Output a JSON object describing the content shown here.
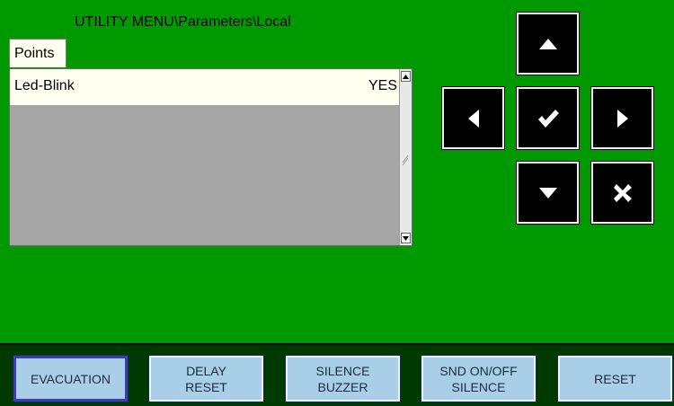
{
  "header": {
    "title": "UTILITY MENU\\Parameters\\Local"
  },
  "tab": {
    "label": "Points"
  },
  "list": {
    "rows": [
      {
        "name": "Led-Blink",
        "value": "YES"
      }
    ]
  },
  "nav": {
    "up": "up-arrow-icon",
    "left": "left-arrow-icon",
    "ok": "check-icon",
    "right": "right-arrow-icon",
    "down": "down-arrow-icon",
    "cancel": "cross-icon"
  },
  "function_buttons": [
    {
      "line1": "EVACUATION",
      "line2": ""
    },
    {
      "line1": "DELAY",
      "line2": "RESET"
    },
    {
      "line1": "SILENCE",
      "line2": "BUZZER"
    },
    {
      "line1": "SND ON/OFF",
      "line2": "SILENCE"
    },
    {
      "line1": "RESET",
      "line2": ""
    }
  ],
  "colors": {
    "screen": "#009900",
    "row_bg": "#fffff0",
    "button_bg": "#a9cfe8",
    "selected_border": "#3b3cb8"
  }
}
